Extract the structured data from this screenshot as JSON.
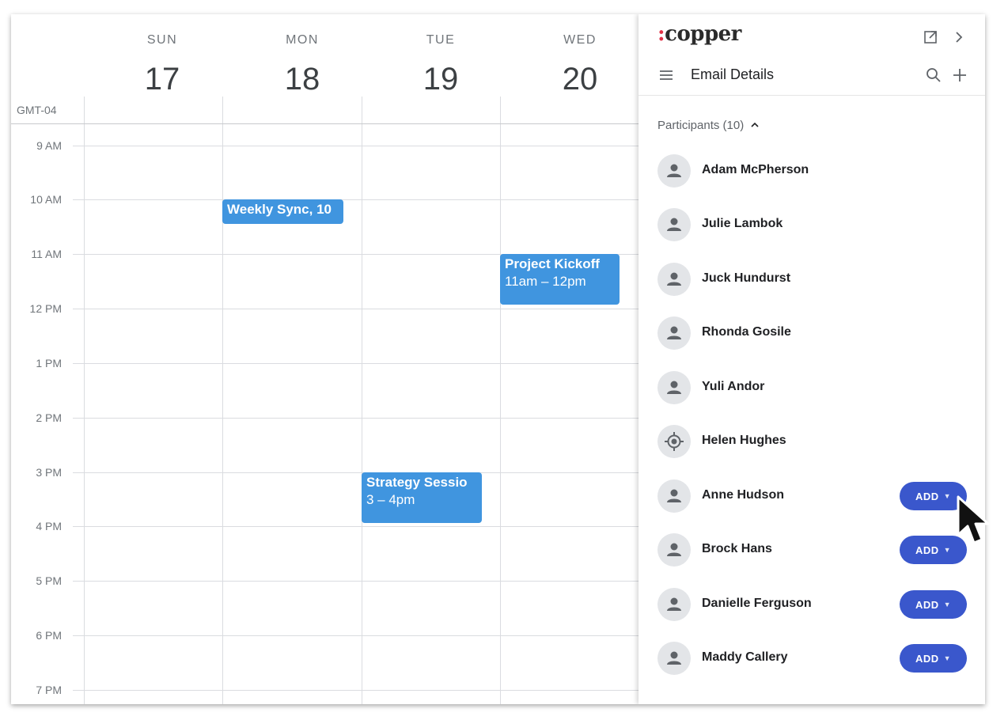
{
  "calendar": {
    "days": [
      {
        "name": "SUN",
        "num": "17"
      },
      {
        "name": "MON",
        "num": "18"
      },
      {
        "name": "TUE",
        "num": "19"
      },
      {
        "name": "WED",
        "num": "20"
      }
    ],
    "timezone": "GMT-04",
    "times": [
      "9 AM",
      "10 AM",
      "11 AM",
      "12 PM",
      "1 PM",
      "2 PM",
      "3 PM",
      "4 PM",
      "5 PM",
      "6 PM",
      "7 PM"
    ],
    "events": [
      {
        "title": "Weekly Sync, 10",
        "time": ""
      },
      {
        "title": "Project Kickoff",
        "time": "11am – 12pm"
      },
      {
        "title": "Strategy Sessio",
        "time": "3 – 4pm"
      }
    ]
  },
  "panel": {
    "logo": "copper",
    "logo_mark": ":",
    "title": "Email Details",
    "participants_header": "Participants (10)",
    "participants": [
      {
        "name": "Adam McPherson"
      },
      {
        "name": "Julie Lambok"
      },
      {
        "name": "Juck Hundurst"
      },
      {
        "name": "Rhonda Gosile"
      },
      {
        "name": "Yuli Andor"
      },
      {
        "name": "Helen Hughes"
      },
      {
        "name": "Anne Hudson",
        "action": "ADD"
      },
      {
        "name": "Brock Hans",
        "action": "ADD"
      },
      {
        "name": "Danielle Ferguson",
        "action": "ADD"
      },
      {
        "name": "Maddy Callery",
        "action": "ADD"
      }
    ]
  },
  "colors": {
    "event": "#4095df",
    "add_button": "#3a57cc",
    "logo_accent": "#e13146"
  },
  "icons": [
    "open-external-icon",
    "chevron-right-icon",
    "menu-icon",
    "search-icon",
    "plus-icon",
    "chevron-up-icon",
    "person-icon",
    "target-icon",
    "caret-down-icon",
    "mouse-cursor-icon"
  ]
}
